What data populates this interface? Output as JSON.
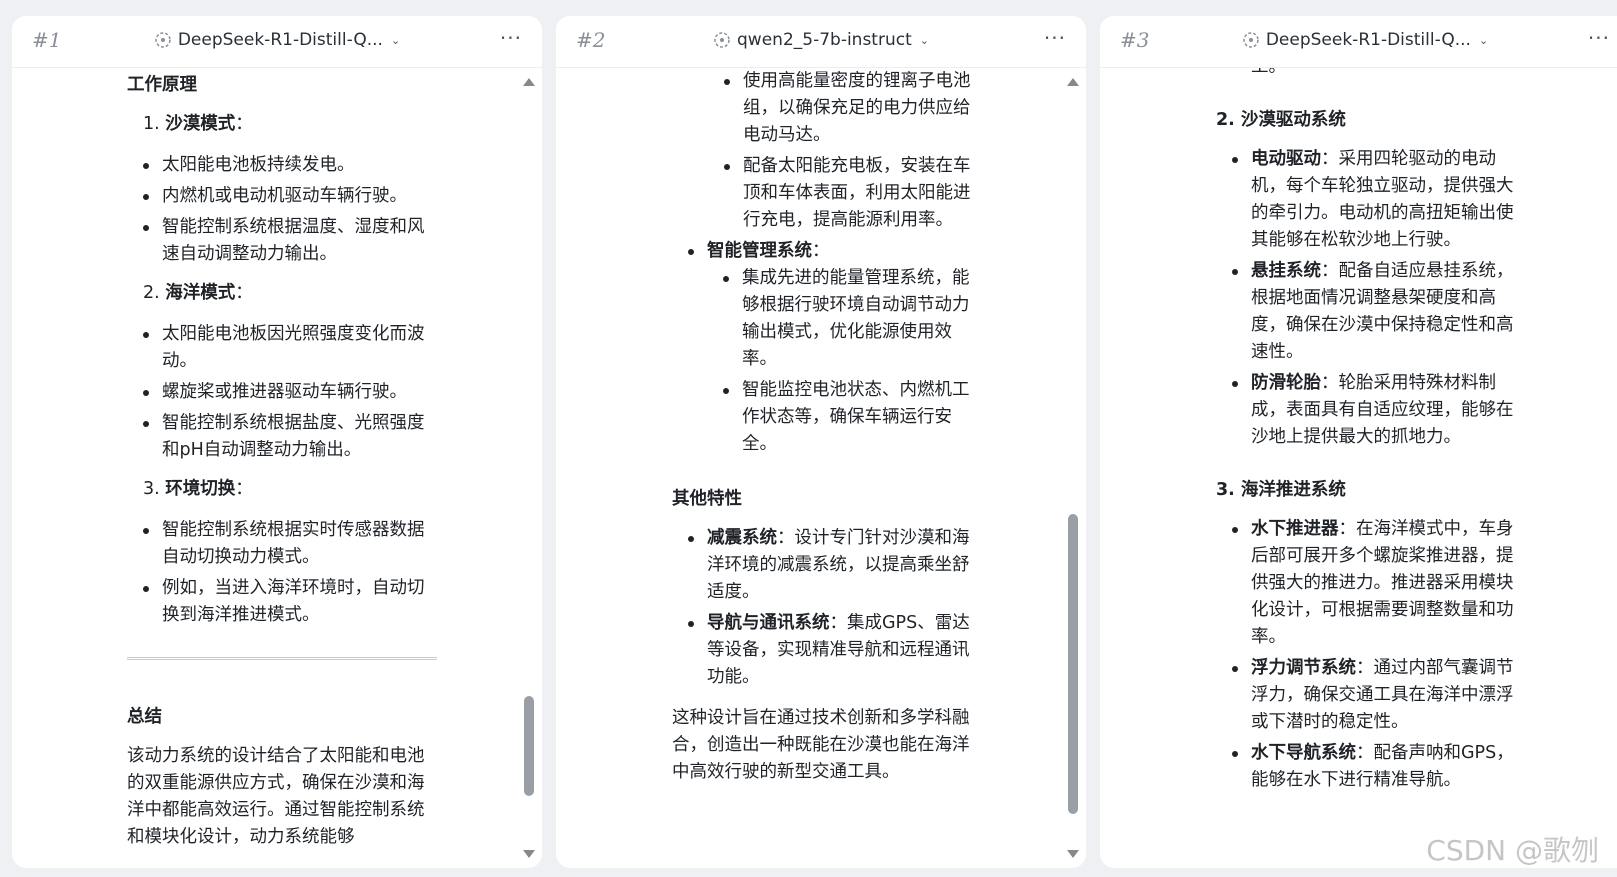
{
  "panels": [
    {
      "num": "#1",
      "model": "DeepSeek-R1-Distill-Q..."
    },
    {
      "num": "#2",
      "model": "qwen2_5-7b-instruct"
    },
    {
      "num": "#3",
      "model": "DeepSeek-R1-Distill-Q..."
    }
  ],
  "more_label": "···",
  "p1": {
    "heading": "工作原理",
    "s1": {
      "num": "1.",
      "title": "沙漠模式",
      "colon": "：",
      "items": [
        "太阳能电池板持续发电。",
        "内燃机或电动机驱动车辆行驶。",
        "智能控制系统根据温度、湿度和风速自动调整动力输出。"
      ]
    },
    "s2": {
      "num": "2.",
      "title": "海洋模式",
      "colon": "：",
      "items": [
        "太阳能电池板因光照强度变化而波动。",
        "螺旋桨或推进器驱动车辆行驶。",
        "智能控制系统根据盐度、光照强度和pH自动调整动力输出。"
      ]
    },
    "s3": {
      "num": "3.",
      "title": "环境切换",
      "colon": "：",
      "items": [
        "智能控制系统根据实时传感器数据自动切换动力模式。",
        "例如，当进入海洋环境时，自动切换到海洋推进模式。"
      ]
    },
    "summary_heading": "总结",
    "summary_text": "该动力系统的设计结合了太阳能和电池的双重能源供应方式，确保在沙漠和海洋中都能高效运行。通过智能控制系统和模块化设计，动力系统能够"
  },
  "p2": {
    "sub1": "使用高能量密度的锂离子电池组，以确保充足的电力供应给电动马达。",
    "sub2": "配备太阳能充电板，安装在车顶和车体表面，利用太阳能进行充电，提高能源利用率。",
    "mgmt_title": "智能管理系统",
    "mgmt_colon": "：",
    "mgmt1": "集成先进的能量管理系统，能够根据行驶环境自动调节动力输出模式，优化能源使用效率。",
    "mgmt2": "智能监控电池状态、内燃机工作状态等，确保车辆运行安全。",
    "other_heading": "其他特性",
    "f1_title": "减震系统",
    "f1_text": "：设计专门针对沙漠和海洋环境的减震系统，以提高乘坐舒适度。",
    "f2_title": "导航与通讯系统",
    "f2_text": "：集成GPS、雷达等设备，实现精准导航和远程通讯功能。",
    "closing": "这种设计旨在通过技术创新和多学科融合，创造出一种既能在沙漠也能在海洋中高效行驶的新型交通工具。"
  },
  "p3": {
    "top_fragment": "工。",
    "h2": "2. 沙漠驱动系统",
    "a1_title": "电动驱动",
    "a1_text": "：采用四轮驱动的电动机，每个车轮独立驱动，提供强大的牵引力。电动机的高扭矩输出使其能够在松软沙地上行驶。",
    "a2_title": "悬挂系统",
    "a2_text": "：配备自适应悬挂系统，根据地面情况调整悬架硬度和高度，确保在沙漠中保持稳定性和高速性。",
    "a3_title": "防滑轮胎",
    "a3_text": "：轮胎采用特殊材料制成，表面具有自适应纹理，能够在沙地上提供最大的抓地力。",
    "h3": "3. 海洋推进系统",
    "b1_title": "水下推进器",
    "b1_text": "：在海洋模式中，车身后部可展开多个螺旋桨推进器，提供强大的推进力。推进器采用模块化设计，可根据需要调整数量和功率。",
    "b2_title": "浮力调节系统",
    "b2_text": "：通过内部气囊调节浮力，确保交通工具在海洋中漂浮或下潜时的稳定性。",
    "b3_title": "水下导航系统",
    "b3_text": "：配备声呐和GPS，能够在水下进行精准导航。"
  },
  "watermark": "CSDN @歌刎"
}
